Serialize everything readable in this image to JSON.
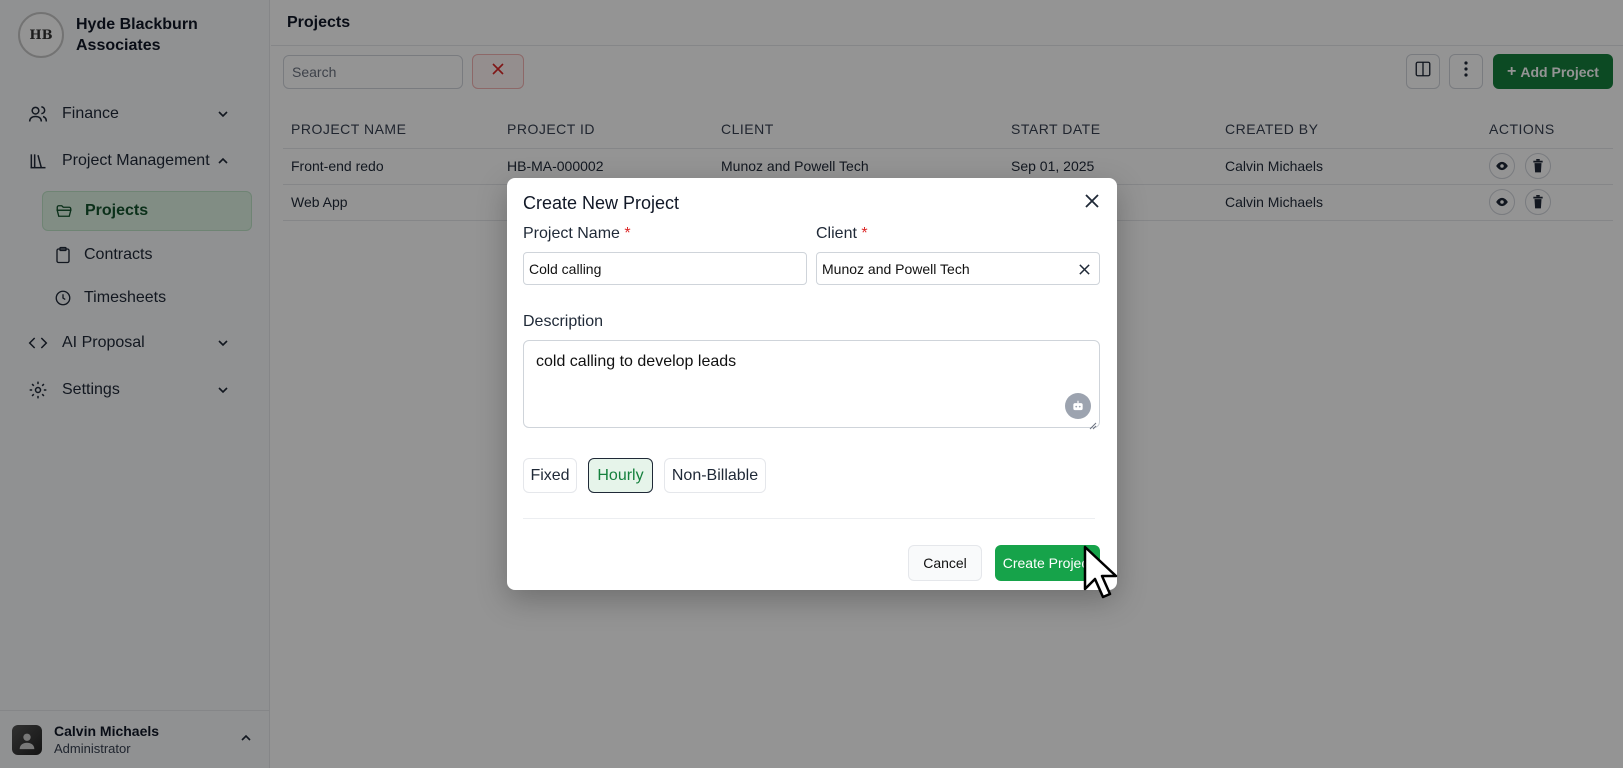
{
  "brand": {
    "name": "Hyde Blackburn Associates",
    "logo_text": "HB"
  },
  "sidebar": {
    "items": [
      {
        "label": "Finance",
        "icon": "users-icon"
      },
      {
        "label": "Project Management",
        "icon": "library-icon"
      },
      {
        "label": "AI Proposal",
        "icon": "code-icon"
      },
      {
        "label": "Settings",
        "icon": "gear-icon"
      }
    ],
    "sub_items": [
      {
        "label": "Projects",
        "icon": "folder-icon",
        "active": true
      },
      {
        "label": "Contracts",
        "icon": "clipboard-icon"
      },
      {
        "label": "Timesheets",
        "icon": "clock-icon"
      }
    ]
  },
  "user": {
    "name": "Calvin Michaels",
    "role": "Administrator"
  },
  "header": {
    "title": "Projects"
  },
  "toolbar": {
    "search_placeholder": "Search",
    "add_label": "Add Project"
  },
  "table": {
    "columns": [
      "PROJECT NAME",
      "PROJECT ID",
      "CLIENT",
      "START DATE",
      "CREATED BY",
      "ACTIONS"
    ],
    "rows": [
      {
        "name": "Front-end redo",
        "id": "HB-MA-000002",
        "client": "Munoz and Powell Tech",
        "start": "Sep 01, 2025",
        "created_by": "Calvin Michaels"
      },
      {
        "name": "Web App",
        "id": "",
        "client": "",
        "start": "",
        "created_by": "Calvin Michaels"
      }
    ]
  },
  "modal": {
    "title": "Create New Project",
    "project_name_label": "Project Name",
    "project_name_value": "Cold calling",
    "client_label": "Client",
    "client_value": "Munoz and Powell Tech",
    "required_marker": "*",
    "description_label": "Description",
    "description_value": "cold calling to develop leads",
    "billing_options": [
      "Fixed",
      "Hourly",
      "Non-Billable"
    ],
    "billing_selected": "Hourly",
    "cancel_label": "Cancel",
    "create_label": "Create Project"
  },
  "colors": {
    "accent": "#15803d",
    "danger": "#dc2626"
  }
}
